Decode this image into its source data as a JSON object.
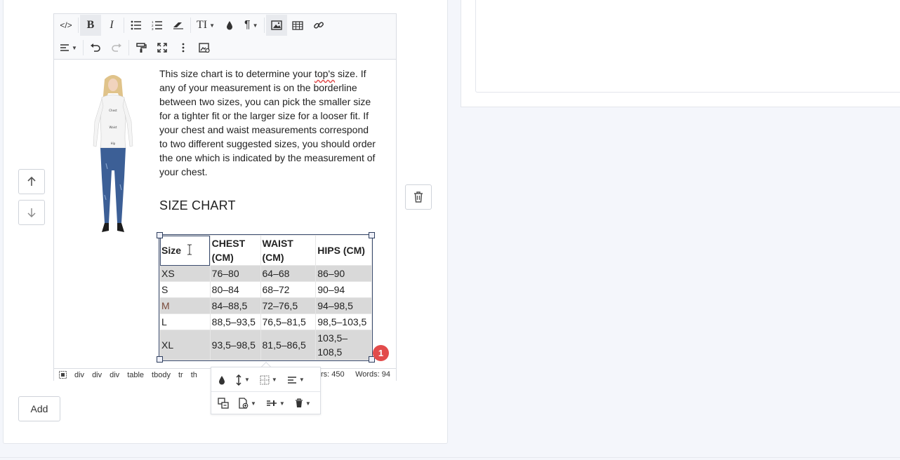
{
  "toolbar": {
    "row1": [
      {
        "name": "source-code-button",
        "glyph": "</>"
      },
      {
        "name": "bold-button",
        "glyph": "B"
      },
      {
        "name": "italic-button",
        "glyph": "I"
      },
      {
        "name": "unordered-list-button",
        "glyph": "ul"
      },
      {
        "name": "ordered-list-button",
        "glyph": "ol"
      },
      {
        "name": "eraser-button",
        "glyph": "eraser"
      },
      {
        "name": "font-size-dropdown",
        "glyph": "TI"
      },
      {
        "name": "text-color-button",
        "glyph": "drop"
      },
      {
        "name": "paragraph-dropdown",
        "glyph": "¶"
      },
      {
        "name": "image-button",
        "glyph": "image"
      },
      {
        "name": "table-button",
        "glyph": "table"
      },
      {
        "name": "link-button",
        "glyph": "link"
      }
    ],
    "row2": [
      {
        "name": "align-dropdown",
        "glyph": "align"
      },
      {
        "name": "undo-button",
        "glyph": "undo"
      },
      {
        "name": "redo-button",
        "glyph": "redo"
      },
      {
        "name": "format-painter-button",
        "glyph": "paint"
      },
      {
        "name": "fullscreen-button",
        "glyph": "expand"
      },
      {
        "name": "more-button",
        "glyph": "dots"
      },
      {
        "name": "image-properties-button",
        "glyph": "imgprops"
      }
    ],
    "source_label": "</>",
    "bold_label": "B",
    "italic_label": "I",
    "font_size_label": "TI",
    "paragraph_label": "¶"
  },
  "content": {
    "paragraph_pre": "This size chart is to determine your ",
    "paragraph_spell": "top's",
    "paragraph_post": " size. If any of your measurement is on the borderline between two sizes, you can pick the smaller size for a tighter fit or the larger size for a looser fit. If your chest and waist measurements correspond to two different suggested sizes, you should order the one which is indicated by the measurement of your chest.",
    "heading": "SIZE CHART",
    "model_labels": [
      "Chest",
      "Waist",
      "Hip"
    ]
  },
  "table": {
    "headers": [
      "Size",
      "CHEST (CM)",
      "WAIST (CM)",
      "HIPS (CM)"
    ],
    "rows": [
      [
        "XS",
        "76–80",
        "64–68",
        "86–90"
      ],
      [
        "S",
        "80–84",
        "68–72",
        "90–94"
      ],
      [
        "M",
        "84–88,5",
        "72–76,5",
        "94–98,5"
      ],
      [
        "L",
        "88,5–93,5",
        "76,5–81,5",
        "98,5–103,5"
      ],
      [
        "XL",
        "93,5–98,5",
        "81,5–86,5",
        "103,5–108,5"
      ]
    ],
    "m_color": "#7a4a3a"
  },
  "statusbar": {
    "breadcrumbs": [
      "div",
      "div",
      "div",
      "table",
      "tbody",
      "tr",
      "th"
    ],
    "chars": "rs: 450",
    "words": "Words: 94"
  },
  "badge": {
    "count": "1"
  },
  "buttons": {
    "add_label": "Add"
  },
  "colors": {
    "accent_handle": "#2e3e5e",
    "badge": "#e24b4b",
    "shade": "#d9d9d9"
  }
}
